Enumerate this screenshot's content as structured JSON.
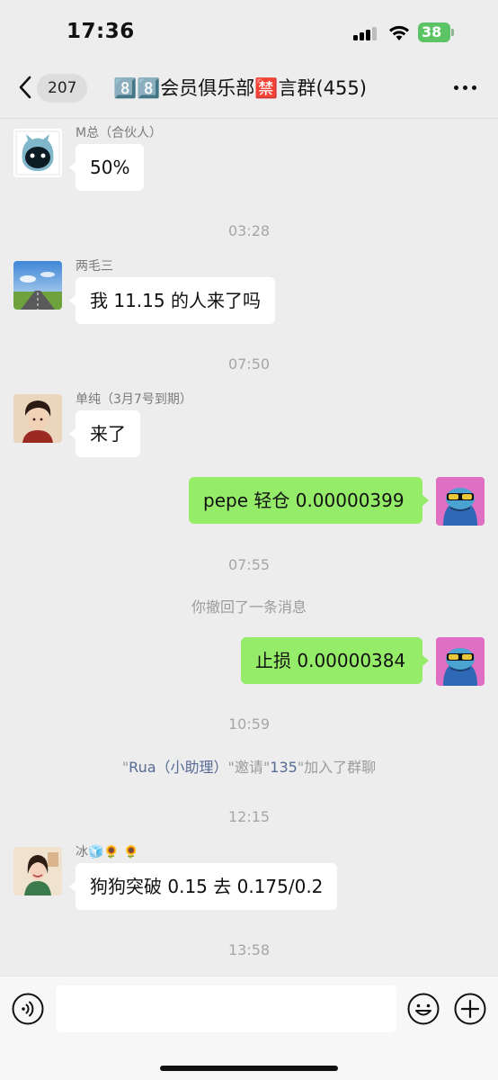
{
  "status_bar": {
    "time": "17:36",
    "battery": "38"
  },
  "nav": {
    "unread_count": "207",
    "title": "8️⃣8️⃣会员俱乐部🈲言群(455)"
  },
  "messages": [
    {
      "sender": "M总（合伙人）",
      "text": "50%"
    },
    {
      "time": "03:28"
    },
    {
      "sender": "两毛三",
      "text": "我 11.15 的人来了吗"
    },
    {
      "time": "07:50"
    },
    {
      "sender": "单纯（3月7号到期）",
      "text": "来了"
    },
    {
      "self_text": "pepe 轻仓 0.00000399"
    },
    {
      "time": "07:55"
    },
    {
      "system": "你撤回了一条消息"
    },
    {
      "self_text": "止损 0.00000384"
    },
    {
      "time": "10:59"
    },
    {
      "system_parts": [
        "\"",
        "Rua（小助理）",
        "\"邀请\"",
        "135",
        "\"加入了群聊"
      ]
    },
    {
      "time": "12:15"
    },
    {
      "sender": "冰🧊🌻 🌻",
      "text": "狗狗突破 0.15 去 0.175/0.2"
    },
    {
      "time": "13:58"
    }
  ],
  "input": {
    "value": "",
    "placeholder": ""
  },
  "icons": {
    "back": "chevron-left-icon",
    "more": "more-dots-icon",
    "voice": "voice-icon",
    "emoji": "emoji-icon",
    "plus": "plus-icon"
  },
  "colors": {
    "self_bubble": "#95ec69",
    "link": "#576b95",
    "battery": "#5dc466"
  }
}
